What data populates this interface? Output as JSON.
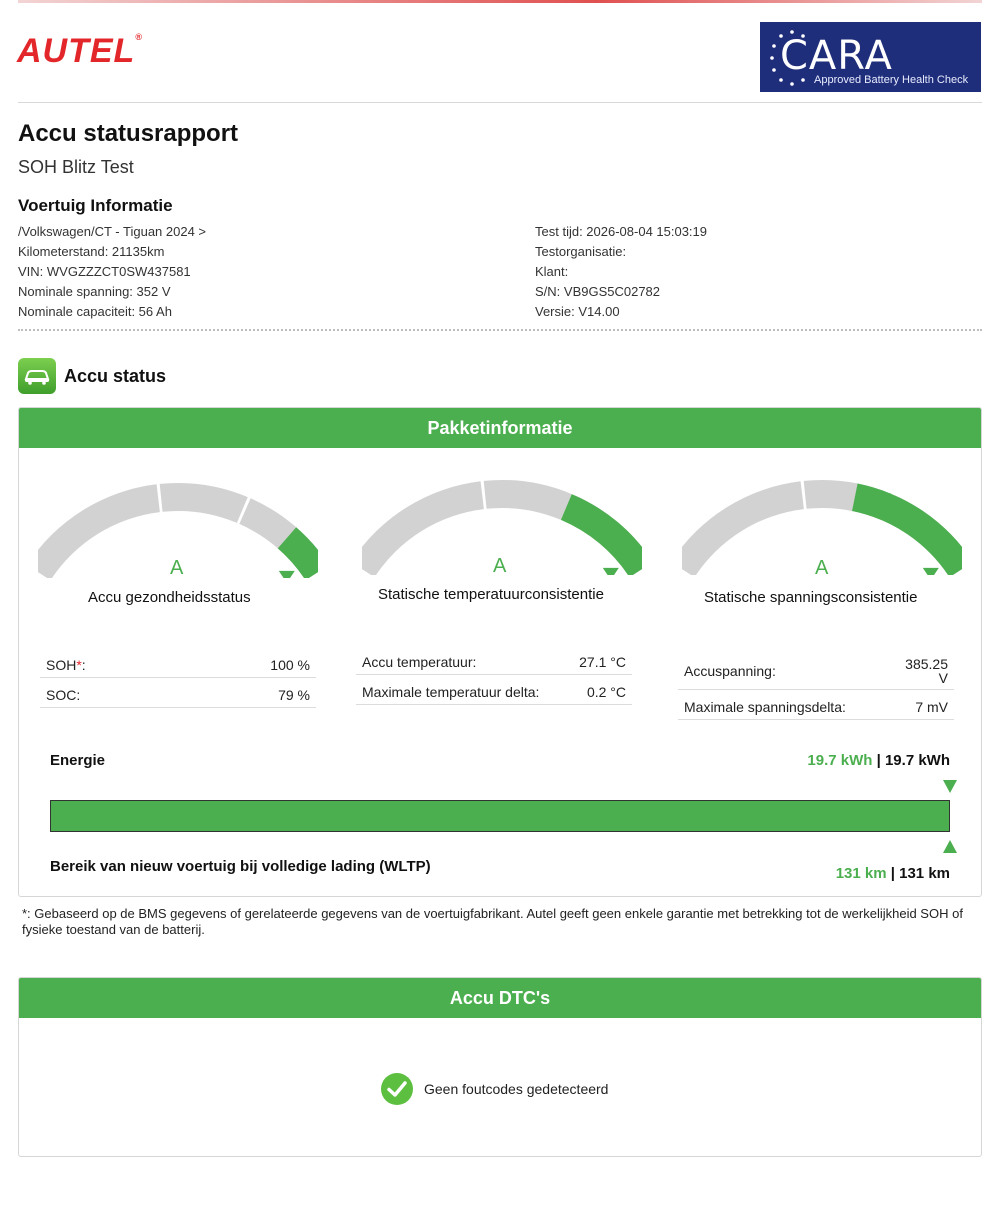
{
  "header": {
    "brand": "AUTEL",
    "brand_mark": "®",
    "badge_word": "CARA",
    "badge_sub": "Approved Battery Health Check"
  },
  "report": {
    "title": "Accu statusrapport",
    "subtitle": "SOH Blitz Test",
    "vehicle_heading": "Voertuig Informatie"
  },
  "vehicle_left": [
    "/Volkswagen/CT - Tiguan 2024 >",
    "Kilometerstand: 21135km",
    "VIN: WVGZZZCT0SW437581",
    "Nominale spanning: 352 V",
    "Nominale capaciteit: 56 Ah"
  ],
  "vehicle_right": [
    "Test tijd: 2026-08-04 15:03:19",
    "Testorganisatie:",
    "Klant:",
    "S/N: VB9GS5C02782",
    "Versie: V14.00"
  ],
  "status": {
    "heading": "Accu status",
    "panel_title": "Pakketinformatie"
  },
  "gauges": [
    {
      "grade": "A",
      "title": "Accu gezondheidsstatus",
      "level": 0.95
    },
    {
      "grade": "A",
      "title": "Statische temperatuurconsistentie",
      "level": 0.8
    },
    {
      "grade": "A",
      "title": "Statische spanningsconsistentie",
      "level": 0.7
    }
  ],
  "health_values": {
    "soh_label": "SOH",
    "soh_mark": "*",
    "soh_suffix": ":",
    "soh_value": "100 %",
    "soc_label": "SOC:",
    "soc_value": "79 %"
  },
  "temp_values": {
    "temp_label": "Accu temperatuur:",
    "temp_value": "27.1 °C",
    "delta_label": "Maximale temperatuur delta:",
    "delta_value": "0.2 °C"
  },
  "volt_values": {
    "volt_label": "Accuspanning:",
    "volt_value_1": "385.25",
    "volt_value_2": "V",
    "delta_label": "Maximale spanningsdelta:",
    "delta_value": "7 mV"
  },
  "energy": {
    "label": "Energie",
    "current": "19.7 kWh",
    "separator": "|",
    "total": "19.7 kWh",
    "fill_fraction": 1.0
  },
  "range": {
    "label": "Bereik van nieuw voertuig bij volledige lading (WLTP)",
    "current": "131 km",
    "separator": "|",
    "total": "131 km"
  },
  "footnote": "*: Gebaseerd op de BMS gegevens of gerelateerde gegevens van de voertuigfabrikant. Autel geeft geen enkele garantie met betrekking tot de werkelijkheid SOH of fysieke toestand van de batterij.",
  "dtc": {
    "panel_title": "Accu DTC's",
    "message": "Geen foutcodes gedetecteerd"
  },
  "colors": {
    "accent_green": "#4caf4f",
    "brand_red": "#e3262a",
    "badge_blue": "#1f2e7a",
    "gauge_grey": "#d2d2d2"
  }
}
